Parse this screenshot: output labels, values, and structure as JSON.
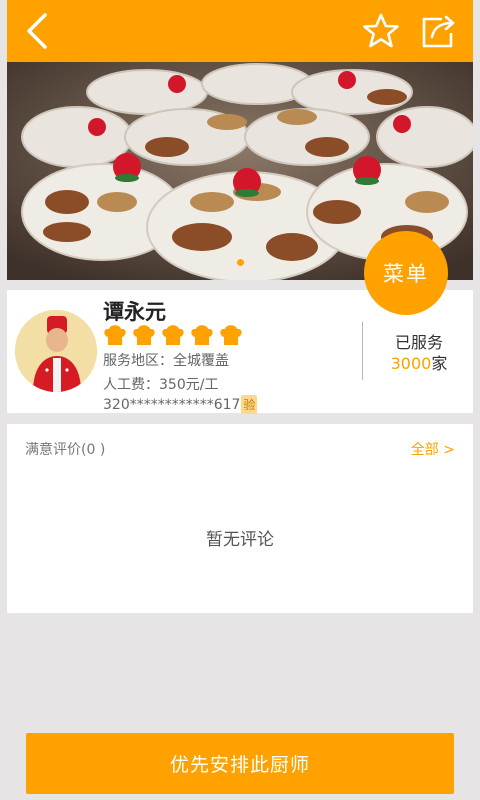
{
  "topbar": {
    "back_icon": "chevron-left-icon",
    "favorite_icon": "star-outline-icon",
    "share_icon": "share-icon",
    "accent": "#ffa200"
  },
  "hero": {
    "image": "banquet-platters-photo",
    "slide_count": 1,
    "active_slide": 1
  },
  "menu_button": {
    "label": "菜单"
  },
  "chef": {
    "name": "谭永元",
    "rating_hats": 5,
    "area_label": "服务地区：",
    "area_value": "全城覆盖",
    "fee_label": "人工费：",
    "fee_value": "350元/工",
    "id_number": "320************617",
    "verify_badge": "验",
    "served_label": "已服务",
    "served_count": "3000",
    "served_unit": "家"
  },
  "reviews": {
    "title": "满意评价(0 )",
    "all_link": "全部 >",
    "empty_text": "暂无评论"
  },
  "cta": {
    "label": "优先安排此厨师"
  }
}
